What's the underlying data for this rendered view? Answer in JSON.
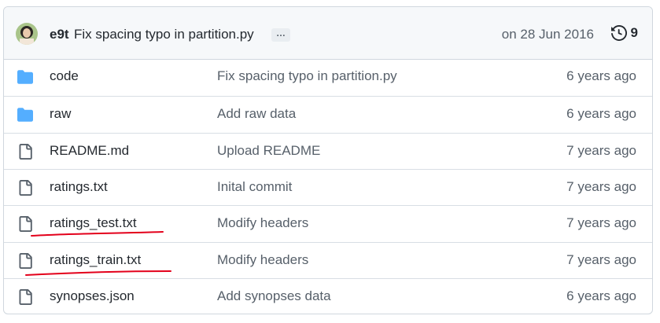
{
  "commit": {
    "author": "e9t",
    "message": "Fix spacing typo in partition.py",
    "ellipsis": "…",
    "date": "on 28 Jun 2016",
    "history_count": "9",
    "avatar_icon": "avatar-photo",
    "history_icon": "history-clock-icon"
  },
  "files": [
    {
      "name": "code",
      "type": "folder",
      "message": "Fix spacing typo in partition.py",
      "age": "6 years ago"
    },
    {
      "name": "raw",
      "type": "folder",
      "message": "Add raw data",
      "age": "6 years ago"
    },
    {
      "name": "README.md",
      "type": "file",
      "message": "Upload README",
      "age": "7 years ago"
    },
    {
      "name": "ratings.txt",
      "type": "file",
      "message": "Inital commit",
      "age": "7 years ago"
    },
    {
      "name": "ratings_test.txt",
      "type": "file",
      "message": "Modify headers",
      "age": "7 years ago"
    },
    {
      "name": "ratings_train.txt",
      "type": "file",
      "message": "Modify headers",
      "age": "7 years ago"
    },
    {
      "name": "synopses.json",
      "type": "file",
      "message": "Add synopses data",
      "age": "6 years ago"
    }
  ],
  "colors": {
    "folder": "#54aeff",
    "file": "#57606a",
    "annotation": "#e3001b"
  }
}
